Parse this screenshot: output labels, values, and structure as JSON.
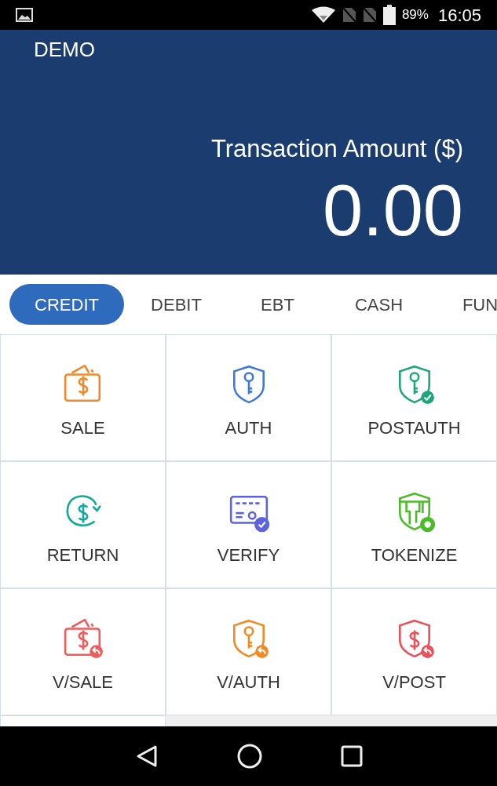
{
  "status_bar": {
    "battery": "89%",
    "time": "16:05"
  },
  "header": {
    "title": "DEMO",
    "amount_label": "Transaction Amount ($)",
    "amount": "0.00"
  },
  "tabs": [
    {
      "label": "CREDIT",
      "selected": true
    },
    {
      "label": "DEBIT",
      "selected": false
    },
    {
      "label": "EBT",
      "selected": false
    },
    {
      "label": "CASH",
      "selected": false
    },
    {
      "label": "FUN",
      "selected": false
    }
  ],
  "actions": [
    {
      "label": "SALE",
      "kind": "sale",
      "color": "#f0892a"
    },
    {
      "label": "AUTH",
      "kind": "auth",
      "color": "#3f78d8"
    },
    {
      "label": "POSTAUTH",
      "kind": "postauth",
      "color": "#1ea67a"
    },
    {
      "label": "RETURN",
      "kind": "return",
      "color": "#14a89c"
    },
    {
      "label": "VERIFY",
      "kind": "verify",
      "color": "#5b63e0"
    },
    {
      "label": "TOKENIZE",
      "kind": "tokenize",
      "color": "#4cbb2a"
    },
    {
      "label": "V/SALE",
      "kind": "voidsale",
      "color": "#ee5c5c"
    },
    {
      "label": "V/AUTH",
      "kind": "voidauth",
      "color": "#f08a24"
    },
    {
      "label": "V/POST",
      "kind": "voidpost",
      "color": "#e9525a"
    }
  ]
}
